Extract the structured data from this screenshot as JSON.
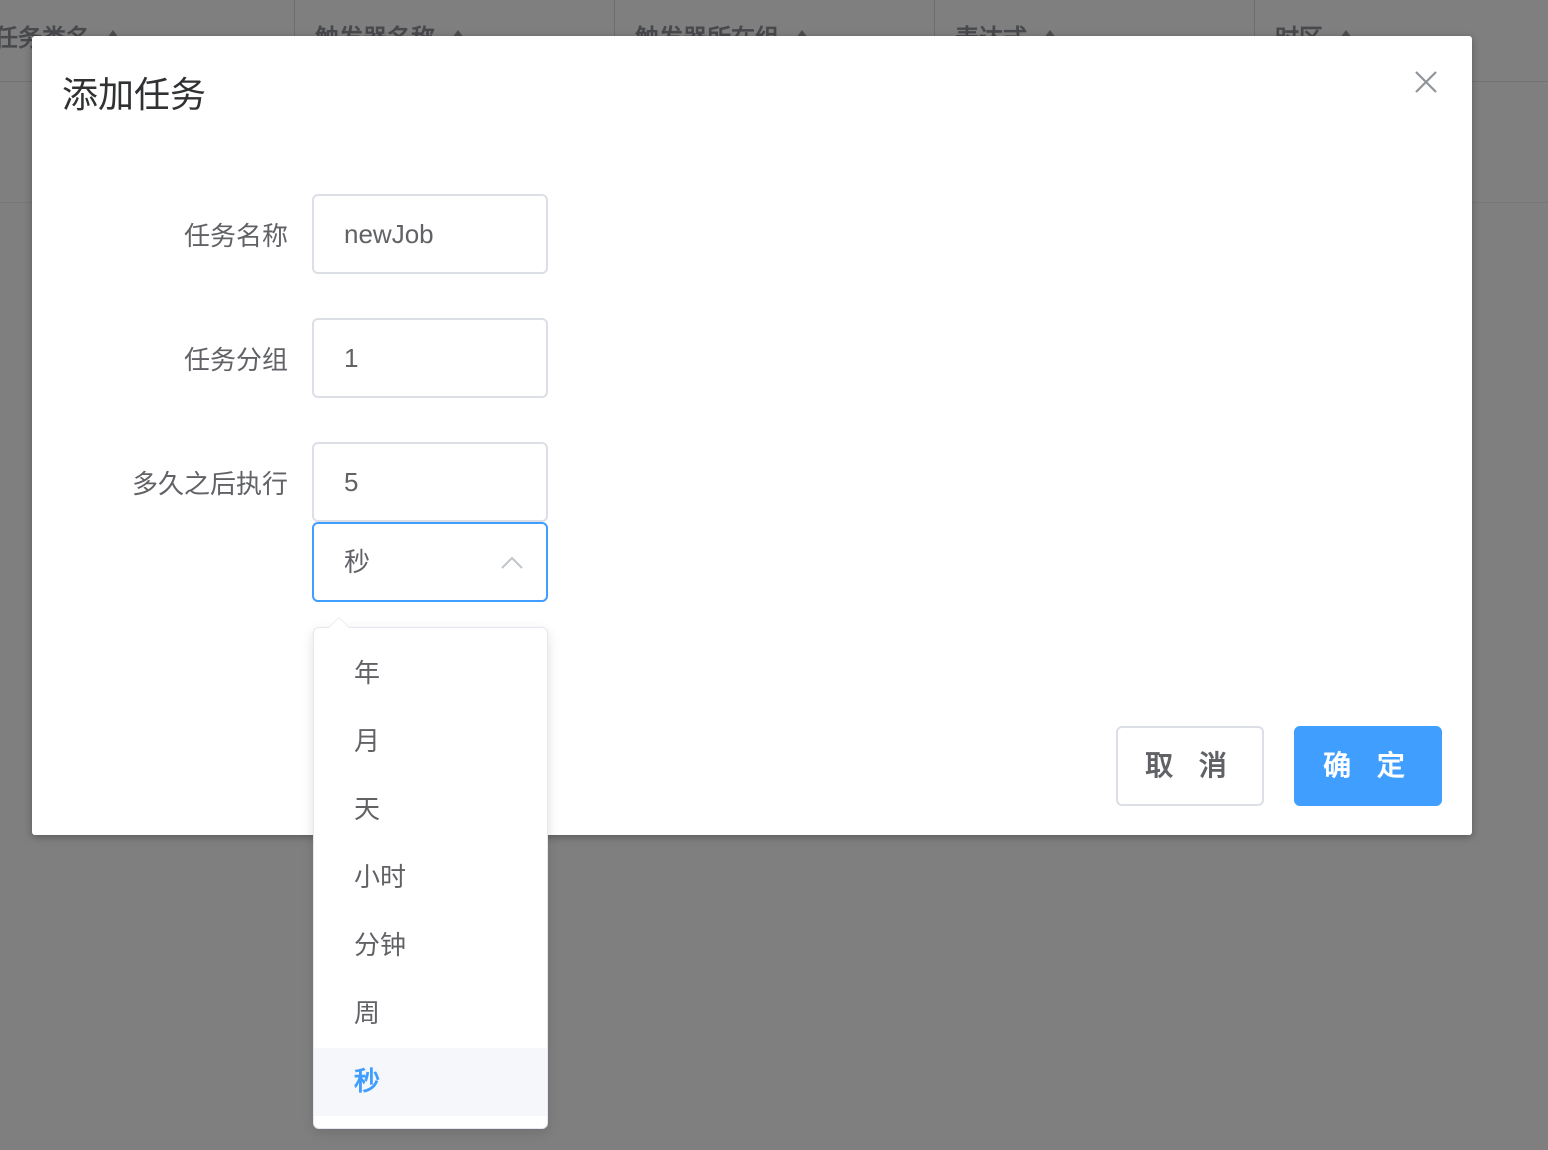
{
  "background_table": {
    "columns": [
      {
        "label": "任务类名",
        "width": 295
      },
      {
        "label": "触发器名称",
        "width": 320
      },
      {
        "label": "触发器所在组",
        "width": 320
      },
      {
        "label": "表达式",
        "width": 320
      },
      {
        "label": "时区",
        "width": 293
      }
    ]
  },
  "dialog": {
    "title": "添加任务",
    "fields": {
      "job_name": {
        "label": "任务名称",
        "value": "newJob"
      },
      "job_group": {
        "label": "任务分组",
        "value": "1"
      },
      "delay": {
        "label": "多久之后执行",
        "value": "5"
      },
      "unit": {
        "value": "秒"
      }
    },
    "buttons": {
      "cancel": "取 消",
      "confirm": "确 定"
    }
  },
  "dropdown": {
    "options": [
      "年",
      "月",
      "天",
      "小时",
      "分钟",
      "周",
      "秒"
    ],
    "selected": "秒"
  },
  "colors": {
    "accent": "#409eff",
    "overlay": "rgba(0,0,0,0.5)"
  }
}
